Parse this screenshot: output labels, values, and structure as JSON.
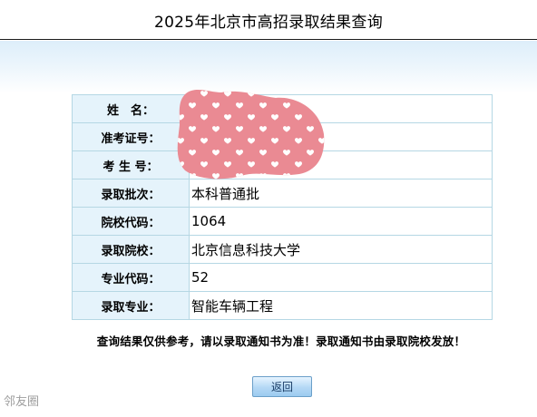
{
  "page": {
    "title": "2025年北京市高招录取结果查询"
  },
  "result_rows": [
    {
      "label": "姓　名：",
      "value": ""
    },
    {
      "label": "准考证号：",
      "value": ""
    },
    {
      "label": "考 生 号：",
      "value": ""
    },
    {
      "label": "录取批次：",
      "value": "本科普通批"
    },
    {
      "label": "院校代码：",
      "value": "1064"
    },
    {
      "label": "录取院校：",
      "value": "北京信息科技大学"
    },
    {
      "label": "专业代码：",
      "value": "52"
    },
    {
      "label": "录取专业：",
      "value": "智能车辆工程"
    }
  ],
  "notice": "查询结果仅供参考，请以录取通知书为准！录取通知书由录取院校发放！",
  "back_button": "返回",
  "watermark": "邻友圈",
  "colors": {
    "label_bg": "#e5f3fb",
    "cell_border": "#b5d7e4",
    "sticker_pink": "#ea8a93",
    "button_top": "#e7f4ff",
    "button_bottom": "#9ccbf0"
  },
  "icons": {
    "privacy_cover": "heart-pattern-sticker"
  }
}
